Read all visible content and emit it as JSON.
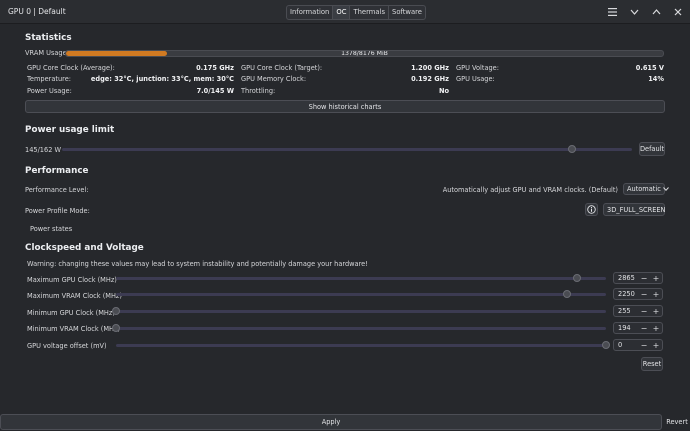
{
  "window": {
    "title": "GPU 0 | Default",
    "tabs": [
      "Information",
      "OC",
      "Thermals",
      "Software"
    ],
    "active_tab": "OC"
  },
  "statistics": {
    "heading": "Statistics",
    "vram_label": "VRAM Usage:",
    "vram_text": "1378/8176 MiB",
    "vram_used": 1378,
    "vram_total": 8176,
    "vram_color": "#d07a22",
    "rows": [
      [
        {
          "label": "GPU Core Clock (Average):",
          "value": "0.175 GHz"
        },
        {
          "label": "GPU Core Clock (Target):",
          "value": "1.200 GHz"
        },
        {
          "label": "GPU Voltage:",
          "value": "0.615 V"
        }
      ],
      [
        {
          "label": "Temperature:",
          "value": "edge: 32°C, junction: 33°C, mem: 30°C"
        },
        {
          "label": "GPU Memory Clock:",
          "value": "0.192 GHz"
        },
        {
          "label": "GPU Usage:",
          "value": "14%"
        }
      ],
      [
        {
          "label": "Power Usage:",
          "value": "7.0/145 W"
        },
        {
          "label": "Throttling:",
          "value": "No"
        }
      ]
    ],
    "history_button": "Show historical charts"
  },
  "power_limit": {
    "heading": "Power usage limit",
    "value_text": "145/162 W",
    "current": 145,
    "max": 162,
    "default_button": "Default"
  },
  "performance": {
    "heading": "Performance",
    "level_label": "Performance Level:",
    "level_description": "Automatically adjust GPU and VRAM clocks. (Default)",
    "level_selected": "Automatic",
    "profile_label": "Power Profile Mode:",
    "profile_value": "3D_FULL_SCREEN",
    "power_states": "Power states"
  },
  "clocks": {
    "heading": "Clockspeed and Voltage",
    "warning": "Warning: changing these values may lead to system instability and potentially damage your hardware!",
    "rows": [
      {
        "label": "Maximum GPU Clock (MHz)",
        "value": "2865",
        "fraction": 0.94
      },
      {
        "label": "Maximum VRAM Clock (MHz)",
        "value": "2250",
        "fraction": 0.92
      },
      {
        "label": "Minimum GPU Clock (MHz)",
        "value": "255",
        "fraction": 0.0
      },
      {
        "label": "Minimum VRAM Clock (MHz)",
        "value": "194",
        "fraction": 0.0
      },
      {
        "label": "GPU voltage offset (mV)",
        "value": "0",
        "fraction": 1.0
      }
    ],
    "reset_button": "Reset"
  },
  "footer": {
    "apply_button": "Apply",
    "revert_button": "Revert"
  }
}
